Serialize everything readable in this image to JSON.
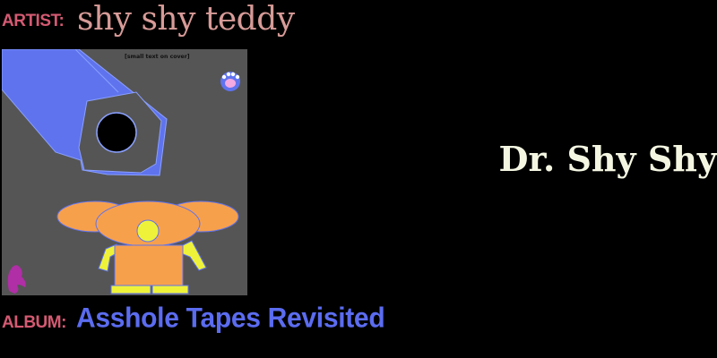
{
  "header": {
    "artist_label": "ARTIST:",
    "artist_name": "shy shy teddy"
  },
  "footer": {
    "album_label": "ALBUM:",
    "album_name": "Asshole Tapes Revisited"
  },
  "now_playing": {
    "title": "Dr. Shy Shy"
  },
  "cover_art": {
    "caption_line_1": "[small text on cover]",
    "caption_line_2": "",
    "icons": [
      "paw-print-icon",
      "horse-head-icon"
    ]
  },
  "colors": {
    "background": "#000000",
    "label": "#d45a72",
    "artist_name": "#d79b98",
    "album_name": "#5b6cf0",
    "title": "#f4f6e2",
    "cover_bg": "#555555",
    "cover_blue": "#5f73ee",
    "cover_orange": "#f7a04c",
    "cover_yellow": "#eef33a"
  }
}
